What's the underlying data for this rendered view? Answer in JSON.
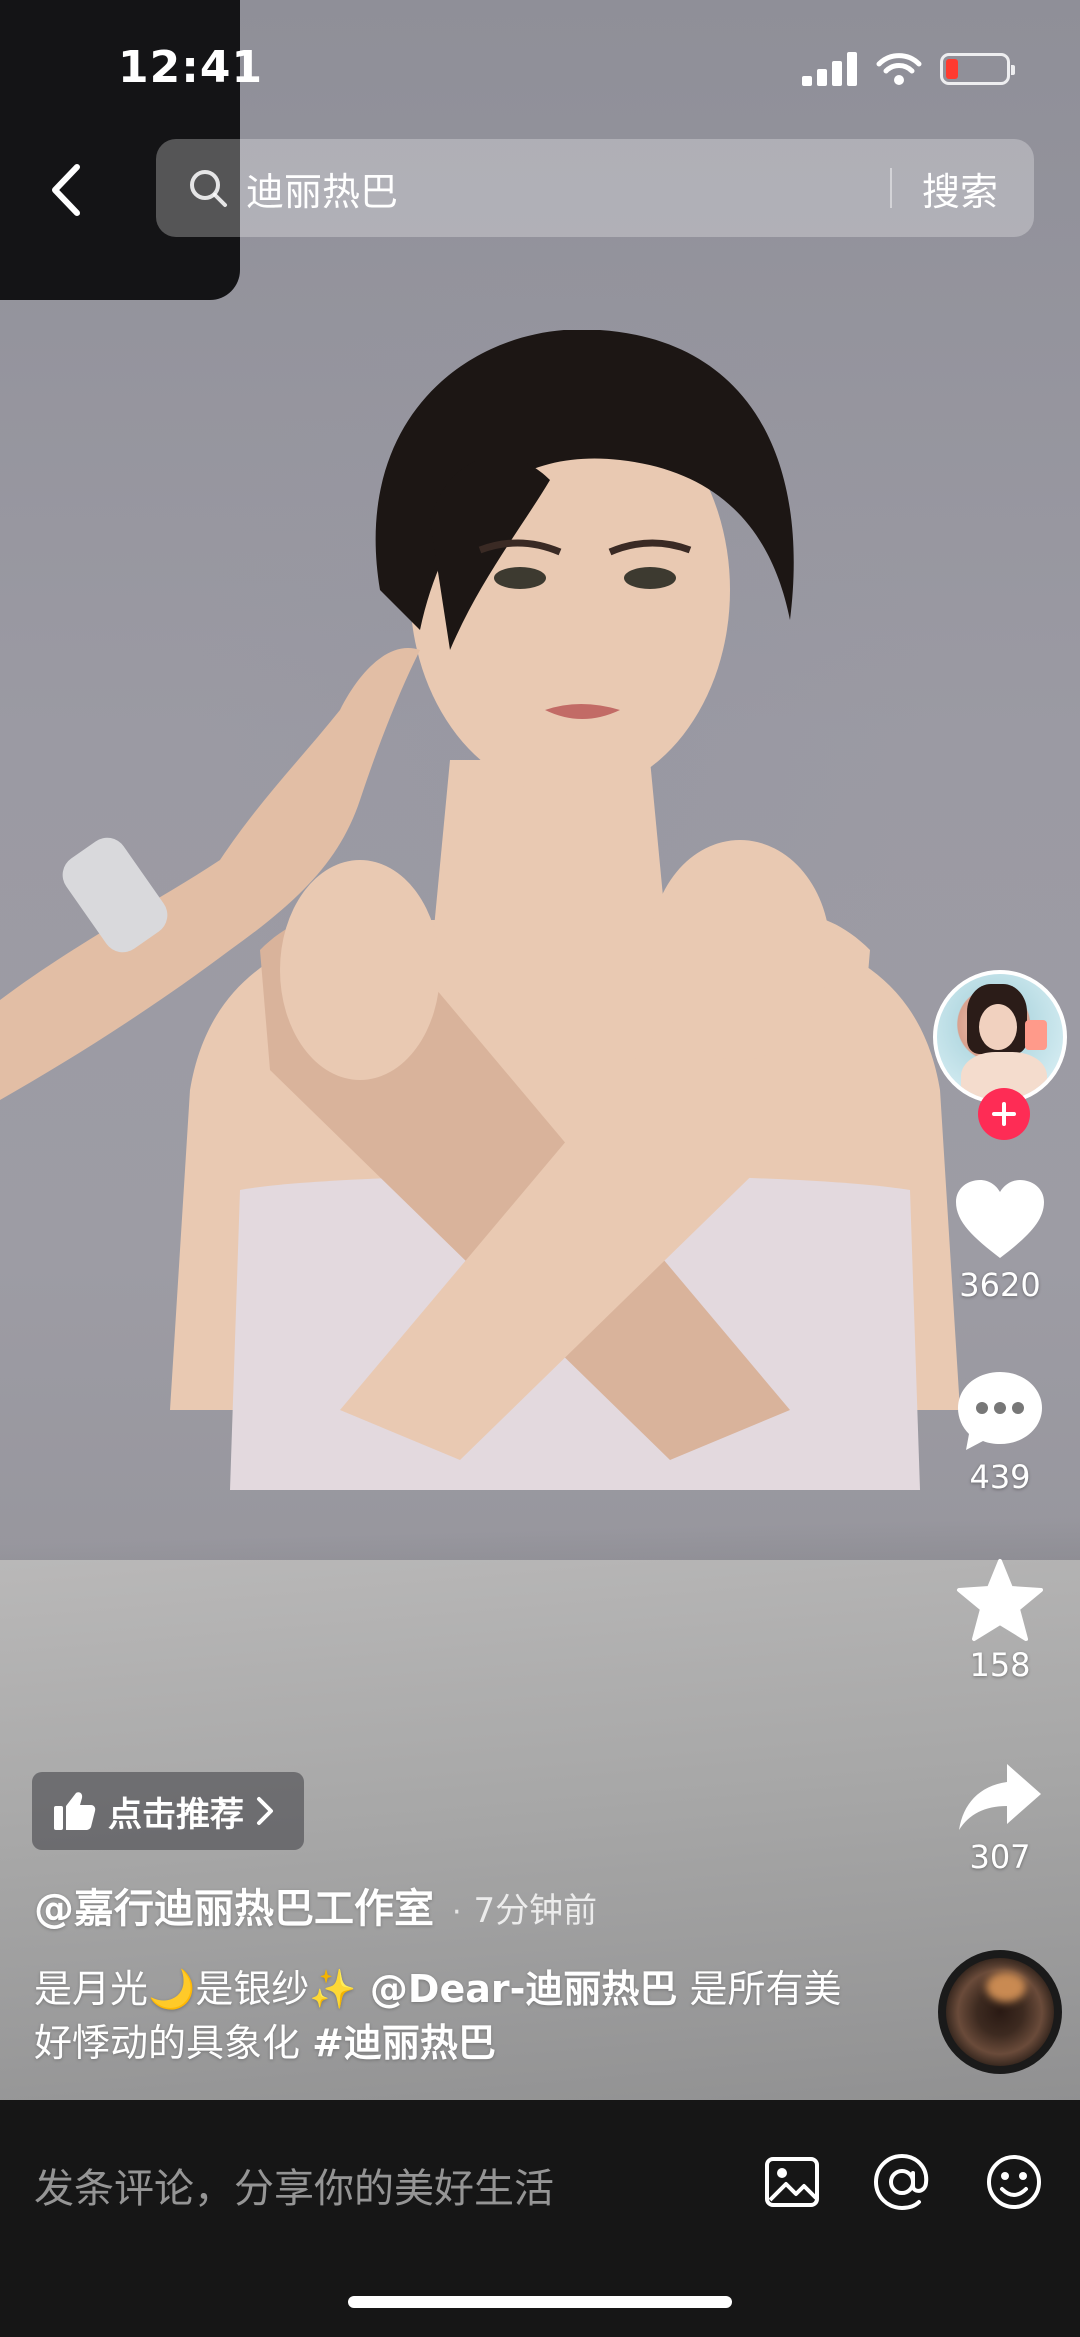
{
  "status_bar": {
    "time": "12:41",
    "battery_color": "#ff3b30"
  },
  "search": {
    "query": "迪丽热巴",
    "button_label": "搜索",
    "icon": "search-icon"
  },
  "actions": {
    "likes": "3620",
    "comments": "439",
    "favorites": "158",
    "shares": "307",
    "accent_color": "#fe2c55"
  },
  "post": {
    "recommend_label": "点击推荐",
    "author": "@嘉行迪丽热巴工作室",
    "separator": "·",
    "time_ago": "7分钟前",
    "caption_parts": {
      "text1": "是月光",
      "emoji1": "🌙",
      "text2": "是银纱",
      "emoji2": "✨",
      "mention": " @Dear-迪丽热巴",
      "text3": " 是所有美好悸动的具象化 ",
      "hashtag": "#迪丽热巴"
    }
  },
  "comment_bar": {
    "placeholder": "发条评论，分享你的美好生活",
    "icons": [
      "image-icon",
      "at-icon",
      "emoji-icon"
    ]
  }
}
